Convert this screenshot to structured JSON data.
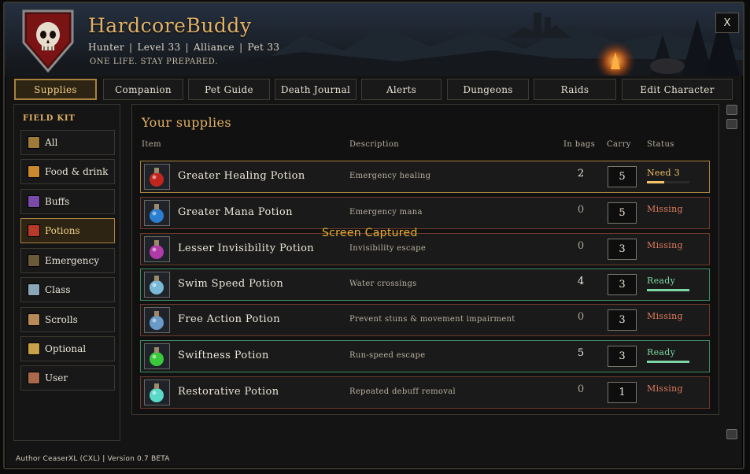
{
  "header": {
    "app_title": "HardcoreBuddy",
    "class": "Hunter",
    "level": "Level 33",
    "faction": "Alliance",
    "pet": "Pet 33",
    "separator": "|",
    "tagline": "ONE LIFE. STAY PREPARED.",
    "close_label": "X"
  },
  "tabs": [
    {
      "label": "Supplies",
      "active": true
    },
    {
      "label": "Companion",
      "active": false
    },
    {
      "label": "Pet Guide",
      "active": false
    },
    {
      "label": "Death Journal",
      "active": false
    },
    {
      "label": "Alerts",
      "active": false
    },
    {
      "label": "Dungeons",
      "active": false
    },
    {
      "label": "Raids",
      "active": false
    },
    {
      "label": "Edit Character",
      "active": false
    }
  ],
  "sidebar": {
    "title": "FIELD KIT",
    "items": [
      {
        "label": "All",
        "icon": "map-icon",
        "color": "#a07a3a",
        "active": false
      },
      {
        "label": "Food & drink",
        "icon": "bread-icon",
        "color": "#c98a2e",
        "active": false
      },
      {
        "label": "Buffs",
        "icon": "buff-icon",
        "color": "#7a4aa8",
        "active": false
      },
      {
        "label": "Potions",
        "icon": "potion-icon",
        "color": "#b83a2a",
        "active": true
      },
      {
        "label": "Emergency",
        "icon": "emergency-icon",
        "color": "#6a5a3a",
        "active": false
      },
      {
        "label": "Class",
        "icon": "class-icon",
        "color": "#8aa6b8",
        "active": false
      },
      {
        "label": "Scrolls",
        "icon": "scroll-icon",
        "color": "#b88a5a",
        "active": false
      },
      {
        "label": "Optional",
        "icon": "optional-icon",
        "color": "#c9a04a",
        "active": false
      },
      {
        "label": "User",
        "icon": "user-icon",
        "color": "#a86a4a",
        "active": false
      }
    ]
  },
  "main": {
    "title": "Your supplies",
    "columns": {
      "item": "Item",
      "description": "Description",
      "in_bags": "In bags",
      "carry": "Carry",
      "status": "Status"
    },
    "rows": [
      {
        "name": "Greater Healing Potion",
        "description": "Emergency healing",
        "in_bags": "2",
        "carry": "5",
        "status": "Need 3",
        "state": "need",
        "progress": 0.4,
        "icon": "red-potion-icon",
        "icon_color": "#c0261e"
      },
      {
        "name": "Greater Mana Potion",
        "description": "Emergency mana",
        "in_bags": "0",
        "carry": "5",
        "status": "Missing",
        "state": "missing",
        "progress": 0,
        "icon": "blue-potion-icon",
        "icon_color": "#2a7fd0"
      },
      {
        "name": "Lesser Invisibility Potion",
        "description": "Invisibility escape",
        "in_bags": "0",
        "carry": "3",
        "status": "Missing",
        "state": "missing",
        "progress": 0,
        "icon": "purple-potion-icon",
        "icon_color": "#b03aa8"
      },
      {
        "name": "Swim Speed Potion",
        "description": "Water crossings",
        "in_bags": "4",
        "carry": "3",
        "status": "Ready",
        "state": "ready",
        "progress": 1,
        "icon": "flask-icon",
        "icon_color": "#7ab8d8"
      },
      {
        "name": "Free Action Potion",
        "description": "Prevent stuns & movement impairment",
        "in_bags": "0",
        "carry": "3",
        "status": "Missing",
        "state": "missing",
        "progress": 0,
        "icon": "bottle-icon",
        "icon_color": "#6a9ac8"
      },
      {
        "name": "Swiftness Potion",
        "description": "Run-speed escape",
        "in_bags": "5",
        "carry": "3",
        "status": "Ready",
        "state": "ready",
        "progress": 1,
        "icon": "green-potion-icon",
        "icon_color": "#3ac83a"
      },
      {
        "name": "Restorative Potion",
        "description": "Repeated debuff removal",
        "in_bags": "0",
        "carry": "1",
        "status": "Missing",
        "state": "missing",
        "progress": 0,
        "icon": "bowl-icon",
        "icon_color": "#5ad8c8"
      }
    ]
  },
  "overlay_text": "Screen Captured",
  "footer": "Author CeaserXL (CXL) | Version 0.7 BETA",
  "colors": {
    "accent_gold": "#e2b266",
    "missing": "#de7a5c",
    "need": "#f0c36a",
    "ready": "#7ed6a4"
  }
}
